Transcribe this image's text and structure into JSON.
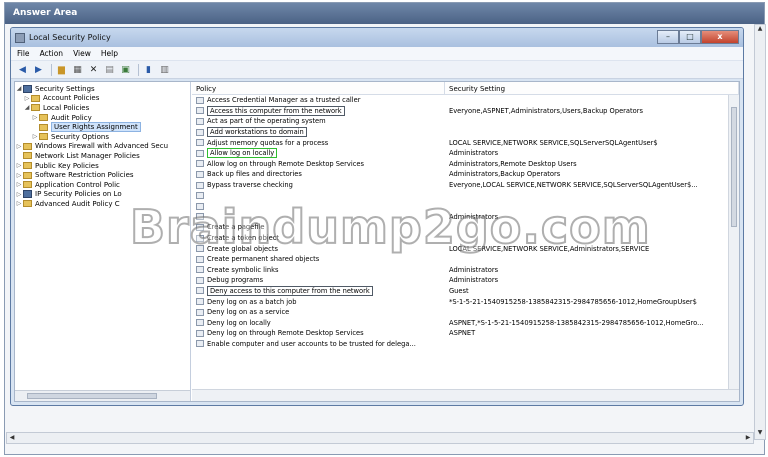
{
  "answer_area": {
    "title": "Answer Area"
  },
  "window": {
    "title": "Local Security Policy",
    "buttons": {
      "minimize": "–",
      "maximize": "□",
      "close": "x"
    }
  },
  "menu": [
    "File",
    "Action",
    "View",
    "Help"
  ],
  "toolbar_icons": [
    "back-arrow-icon",
    "forward-arrow-icon",
    "up-folder-icon",
    "show-hide-tree-icon",
    "delete-icon",
    "properties-icon",
    "export-icon",
    "help-icon",
    "view-icon"
  ],
  "tree": [
    {
      "label": "Security Settings",
      "depth": 0,
      "expanded": true,
      "icon": "shield-icon"
    },
    {
      "label": "Account Policies",
      "depth": 1,
      "expanded": false,
      "icon": "folder-icon"
    },
    {
      "label": "Local Policies",
      "depth": 1,
      "expanded": true,
      "icon": "folder-icon"
    },
    {
      "label": "Audit Policy",
      "depth": 2,
      "expanded": false,
      "icon": "folder-icon"
    },
    {
      "label": "User Rights Assignment",
      "depth": 2,
      "selected": true,
      "icon": "folder-icon"
    },
    {
      "label": "Security Options",
      "depth": 2,
      "expanded": false,
      "icon": "folder-icon"
    },
    {
      "label": "Windows Firewall with Advanced Secu",
      "depth": 1,
      "expanded": false,
      "icon": "folder-icon"
    },
    {
      "label": "Network List Manager Policies",
      "depth": 1,
      "icon": "folder-icon"
    },
    {
      "label": "Public Key Policies",
      "depth": 1,
      "expanded": false,
      "icon": "folder-icon"
    },
    {
      "label": "Software Restriction Policies",
      "depth": 1,
      "expanded": false,
      "icon": "folder-icon"
    },
    {
      "label": "Application Control Polic",
      "depth": 1,
      "expanded": false,
      "icon": "folder-icon"
    },
    {
      "label": "IP Security Policies on Lo",
      "depth": 1,
      "expanded": false,
      "icon": "shield-icon"
    },
    {
      "label": "Advanced Audit Policy C",
      "depth": 1,
      "expanded": false,
      "icon": "folder-icon"
    }
  ],
  "list": {
    "headers": [
      "Policy",
      "Security Setting"
    ],
    "rows": [
      {
        "policy": "Access Credential Manager as a trusted caller",
        "setting": ""
      },
      {
        "policy": "Access this computer from the network",
        "setting": "Everyone,ASPNET,Administrators,Users,Backup Operators",
        "style": "boxed"
      },
      {
        "policy": "Act as part of the operating system",
        "setting": ""
      },
      {
        "policy": "Add workstations to domain",
        "setting": "",
        "style": "boxed"
      },
      {
        "policy": "Adjust memory quotas for a process",
        "setting": "LOCAL SERVICE,NETWORK SERVICE,SQLServerSQLAgentUser$"
      },
      {
        "policy": "Allow log on locally",
        "setting": "Administrators",
        "style": "green"
      },
      {
        "policy": "Allow log on through Remote Desktop Services",
        "setting": "Administrators,Remote Desktop Users"
      },
      {
        "policy": "Back up files and directories",
        "setting": "Administrators,Backup Operators"
      },
      {
        "policy": "Bypass traverse checking",
        "setting": "Everyone,LOCAL SERVICE,NETWORK SERVICE,SQLServerSQLAgentUser$..."
      },
      {
        "policy": "",
        "setting": ""
      },
      {
        "policy": "",
        "setting": ""
      },
      {
        "policy": "",
        "setting": "Administrators"
      },
      {
        "policy": "Create a pagefile",
        "setting": ""
      },
      {
        "policy": "Create a token object",
        "setting": ""
      },
      {
        "policy": "Create global objects",
        "setting": "LOCAL SERVICE,NETWORK SERVICE,Administrators,SERVICE"
      },
      {
        "policy": "Create permanent shared objects",
        "setting": ""
      },
      {
        "policy": "Create symbolic links",
        "setting": "Administrators"
      },
      {
        "policy": "Debug programs",
        "setting": "Administrators"
      },
      {
        "policy": "Deny access to this computer from the network",
        "setting": "Guest",
        "style": "boxed"
      },
      {
        "policy": "Deny log on as a batch job",
        "setting": "*S-1-5-21-1540915258-1385842315-2984785656-1012,HomeGroupUser$"
      },
      {
        "policy": "Deny log on as a service",
        "setting": ""
      },
      {
        "policy": "Deny log on locally",
        "setting": "ASPNET,*S-1-5-21-1540915258-1385842315-2984785656-1012,HomeGro..."
      },
      {
        "policy": "Deny log on through Remote Desktop Services",
        "setting": "ASPNET"
      },
      {
        "policy": "Enable computer and user accounts to be trusted for delega...",
        "setting": ""
      }
    ]
  },
  "watermark": "Braindump2go.com"
}
